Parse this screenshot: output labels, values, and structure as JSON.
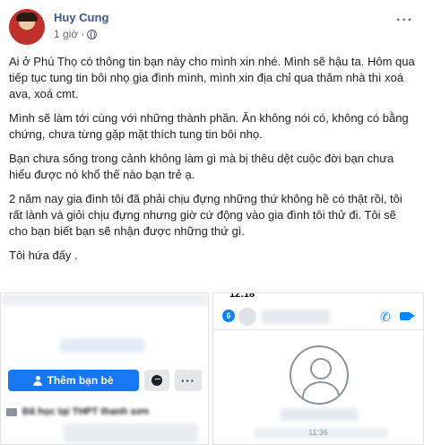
{
  "post": {
    "author": "Huy Cung",
    "time": "1 giờ",
    "more_label": "···",
    "paragraphs": [
      "Ai ở Phú Thọ có thông tin bạn này cho mình xin nhé. Mình sẽ hậu ta. Hôm qua tiếp tục tung tin bôi nhọ gia đình mình, mình xin địa chỉ qua thăm nhà thì xoá ava, xoá cmt.",
      "Mình sẽ làm tới cùng với những thành phần. Ăn không nói có, không có bằng chứng, chưa từng gặp mặt thích tung tin bôi nhọ.",
      "Bạn chưa sống trong cảnh không làm gì mà bị thêu dệt cuộc đời bạn chưa hiểu được nó khổ thế nào bạn trẻ ạ.",
      "2 năm nay gia đình tôi đã phải chịu đựng những thứ không hề có thật rồi, tôi rất lành và giỏi chịu đựng nhưng giờ cứ động vào gia đình tôi thử đi. Tôi sẽ cho bạn biết bạn sẽ nhận được những thứ gì.",
      "Tôi hứa đấy ."
    ]
  },
  "left_screenshot": {
    "add_friend_label": "Thêm bạn bè",
    "options_label": "···",
    "work_text": "Đã học tại THPT thanh sơn"
  },
  "right_screenshot": {
    "status_time": "12:18",
    "back_badge": "6",
    "call_glyph": "✆",
    "message_time": "11:36"
  },
  "colors": {
    "author_link": "#385898",
    "primary_button": "#1877f2",
    "messenger_blue": "#0084ff"
  }
}
